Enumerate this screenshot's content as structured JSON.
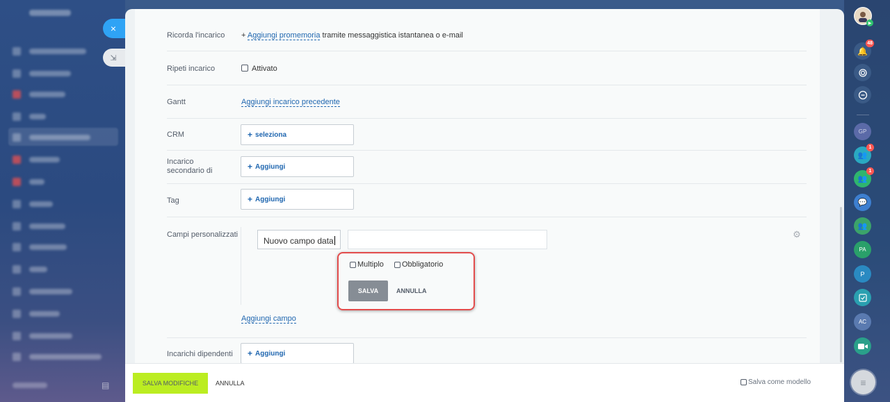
{
  "close_icon": "×",
  "collapse_icon": "⇲",
  "rows": {
    "reminder": {
      "label": "Ricorda l'incarico",
      "plus": "+",
      "link": "Aggiungi promemoria",
      "suffix": " tramite messaggistica istantanea o e-mail"
    },
    "repeat": {
      "label": "Ripeti incarico",
      "checkbox_label": "Attivato"
    },
    "gantt": {
      "label": "Gantt",
      "link": "Aggiungi incarico precedente"
    },
    "crm": {
      "label": "CRM",
      "button": "seleziona"
    },
    "subtask": {
      "label": "Incarico secondario di",
      "button": "Aggiungi"
    },
    "tag": {
      "label": "Tag",
      "button": "Aggiungi"
    },
    "custom": {
      "label": "Campi personalizzati",
      "field_name_value": "Nuovo campo data",
      "multiple_label": "Multiplo",
      "required_label": "Obbligatorio",
      "save_label": "SALVA",
      "cancel_label": "ANNULLA",
      "add_field_link": "Aggiungi campo"
    },
    "dependent": {
      "label": "Incarichi dipendenti",
      "button": "Aggiungi"
    }
  },
  "plus_sign": "+",
  "footer": {
    "save_label": "SALVA MODIFICHE",
    "cancel_label": "ANNULLA",
    "template_label": "Salva come modello"
  },
  "right_sidebar": {
    "notifications_badge": "48",
    "group1_badge": "1",
    "group2_badge": "1",
    "gp_label": "GP",
    "pa_label": "PA",
    "p_label": "P",
    "ac_label": "AC"
  },
  "colors": {
    "accent_link": "#2067b0",
    "save_green": "#bbed21",
    "highlight_red": "#e34c4c",
    "close_blue": "#2fa3f5"
  }
}
